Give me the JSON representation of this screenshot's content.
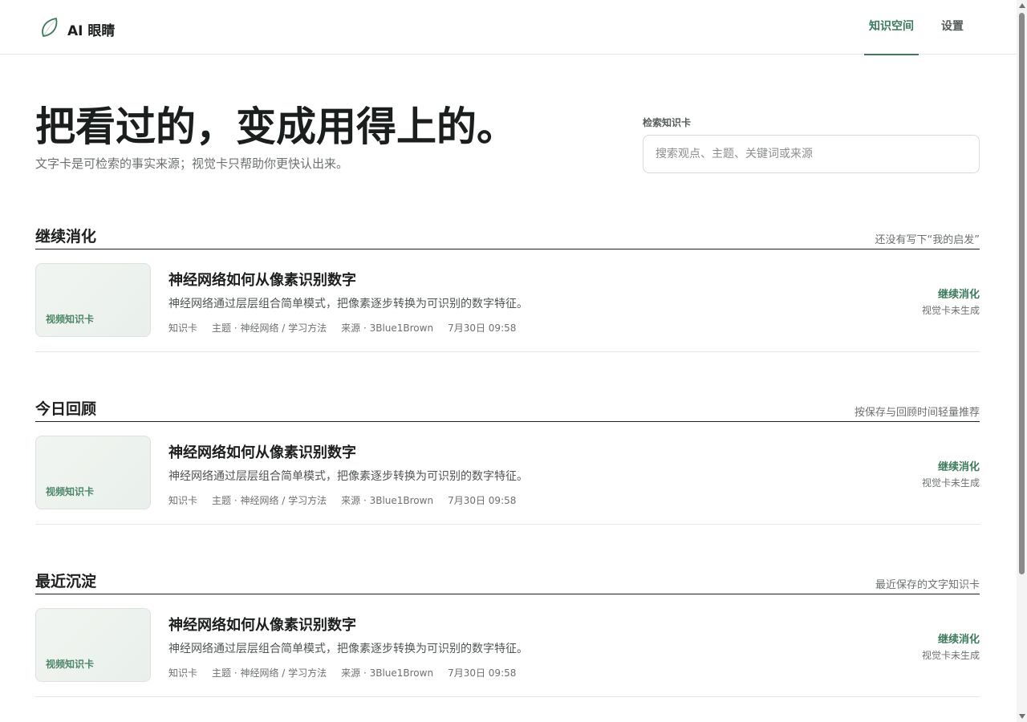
{
  "app": {
    "brand": "AI 眼睛"
  },
  "nav": {
    "items": [
      {
        "label": "知识空间",
        "active": true
      },
      {
        "label": "设置",
        "active": false
      }
    ]
  },
  "hero": {
    "title": "把看过的，变成用得上的。",
    "subtitle": "文字卡是可检索的事实来源；视觉卡只帮助你更快认出来。"
  },
  "search": {
    "label": "检索知识卡",
    "value": "",
    "placeholder": "搜索观点、主题、关键词或来源"
  },
  "sections": [
    {
      "title": "继续消化",
      "note": "还没有写下“我的启发”",
      "cards": [
        {
          "thumb_label": "视频知识卡",
          "title": "神经网络如何从像素识别数字",
          "description": "神经网络通过层层组合简单模式，把像素逐步转换为可识别的数字特征。",
          "type": "知识卡",
          "topic": "主题 · 神经网络 / 学习方法",
          "source": "来源 · 3Blue1Brown",
          "time": "7月30日 09:58",
          "status": "继续消化",
          "substatus": "视觉卡未生成"
        }
      ]
    },
    {
      "title": "今日回顾",
      "note": "按保存与回顾时间轻量推荐",
      "cards": [
        {
          "thumb_label": "视频知识卡",
          "title": "神经网络如何从像素识别数字",
          "description": "神经网络通过层层组合简单模式，把像素逐步转换为可识别的数字特征。",
          "type": "知识卡",
          "topic": "主题 · 神经网络 / 学习方法",
          "source": "来源 · 3Blue1Brown",
          "time": "7月30日 09:58",
          "status": "继续消化",
          "substatus": "视觉卡未生成"
        }
      ]
    },
    {
      "title": "最近沉淀",
      "note": "最近保存的文字知识卡",
      "cards": [
        {
          "thumb_label": "视频知识卡",
          "title": "神经网络如何从像素识别数字",
          "description": "神经网络通过层层组合简单模式，把像素逐步转换为可识别的数字特征。",
          "type": "知识卡",
          "topic": "主题 · 神经网络 / 学习方法",
          "source": "来源 · 3Blue1Brown",
          "time": "7月30日 09:58",
          "status": "继续消化",
          "substatus": "视觉卡未生成"
        }
      ]
    }
  ],
  "icons": {
    "brand": "leaf-icon"
  },
  "colors": {
    "accent": "#3d7a5c",
    "text": "#1c1f1d",
    "muted": "#6c716e"
  }
}
